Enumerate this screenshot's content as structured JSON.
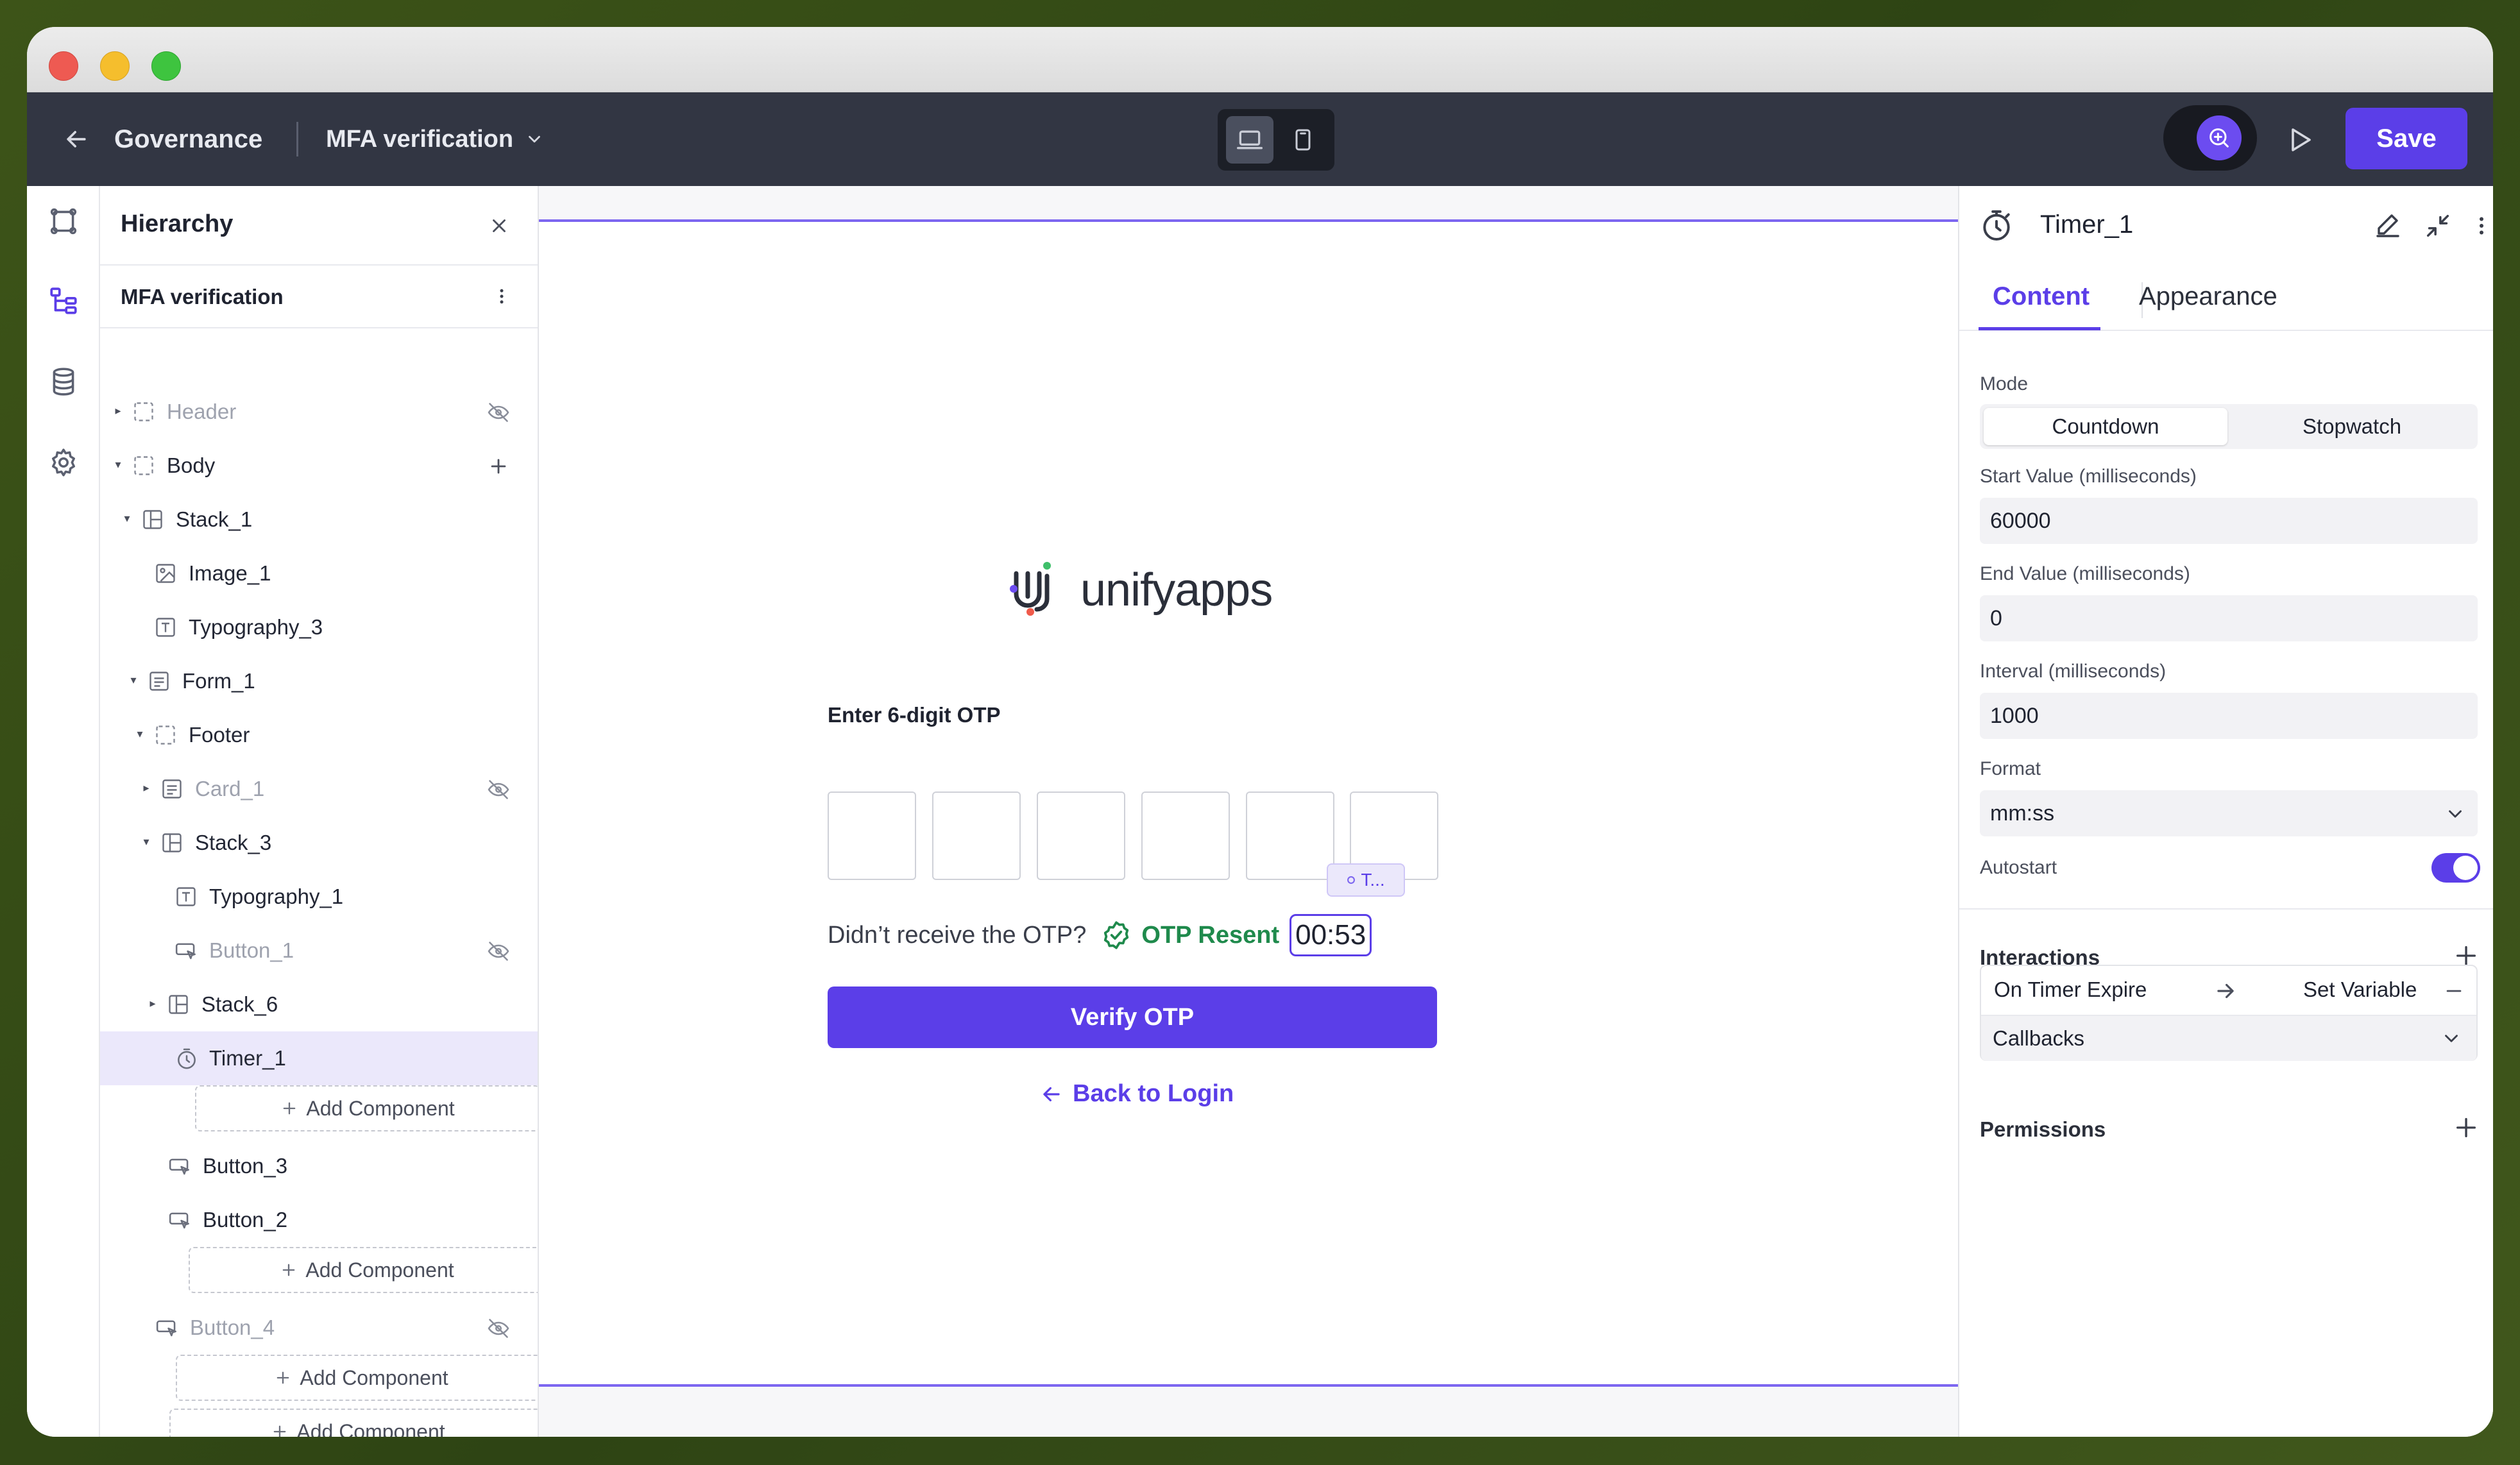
{
  "topbar": {
    "back_label": "",
    "app_name": "Governance",
    "page_name": "MFA verification",
    "save_label": "Save"
  },
  "hierarchy": {
    "title": "Hierarchy",
    "page": "MFA verification",
    "nodes": [
      {
        "label": "Header"
      },
      {
        "label": "Body"
      },
      {
        "label": "Stack_1"
      },
      {
        "label": "Image_1"
      },
      {
        "label": "Typography_3"
      },
      {
        "label": "Form_1"
      },
      {
        "label": "Footer"
      },
      {
        "label": "Card_1"
      },
      {
        "label": "Stack_3"
      },
      {
        "label": "Typography_1"
      },
      {
        "label": "Button_1"
      },
      {
        "label": "Stack_6"
      },
      {
        "label": "Timer_1"
      },
      {
        "label": "Button_3"
      },
      {
        "label": "Button_2"
      },
      {
        "label": "Button_4"
      }
    ],
    "add_component_label": "Add Component"
  },
  "canvas": {
    "logo_text": "unifyapps",
    "otp_label": "Enter 6-digit OTP",
    "resend_question": "Didn’t receive the OTP?",
    "resent_label": "OTP Resent",
    "timer_value": "00:53",
    "timer_tag": "T...",
    "verify_label": "Verify OTP",
    "back_login_label": "Back to Login"
  },
  "properties": {
    "component_name": "Timer_1",
    "tabs": [
      "Content",
      "Appearance"
    ],
    "mode_label": "Mode",
    "mode_options": [
      "Countdown",
      "Stopwatch"
    ],
    "mode_selected": "Countdown",
    "start_label": "Start Value (milliseconds)",
    "start_value": "60000",
    "end_label": "End Value (milliseconds)",
    "end_value": "0",
    "interval_label": "Interval (milliseconds)",
    "interval_value": "1000",
    "format_label": "Format",
    "format_value": "mm:ss",
    "autostart_label": "Autostart",
    "autostart_on": true,
    "interactions_title": "Interactions",
    "interaction_trigger": "On Timer Expire",
    "interaction_action": "Set Variable",
    "callbacks_label": "Callbacks",
    "permissions_title": "Permissions"
  },
  "colors": {
    "accent": "#5b3ee8",
    "topbar": "#323643",
    "success": "#1f8a4c"
  }
}
